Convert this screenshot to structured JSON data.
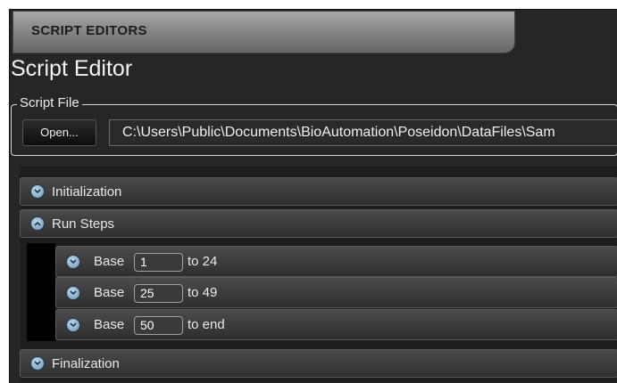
{
  "tab": {
    "label": "SCRIPT EDITORS"
  },
  "page": {
    "title": "Script Editor"
  },
  "script_file": {
    "legend": "Script File",
    "open_label": "Open...",
    "path": "C:\\Users\\Public\\Documents\\BioAutomation\\Poseidon\\DataFiles\\Sam"
  },
  "sections": {
    "initialization": "Initialization",
    "run_steps": "Run Steps",
    "finalization": "Finalization"
  },
  "steps": [
    {
      "base_label": "Base",
      "start": "1",
      "range_label": "to 24"
    },
    {
      "base_label": "Base",
      "start": "25",
      "range_label": "to 49"
    },
    {
      "base_label": "Base",
      "start": "50",
      "range_label": "to end"
    }
  ],
  "icons": {
    "collapsed": "chevron-down-icon",
    "expanded": "chevron-up-icon"
  },
  "colors": {
    "background": "#262626",
    "tab": "#8b8b8b",
    "expander": "#8fb4d1"
  }
}
